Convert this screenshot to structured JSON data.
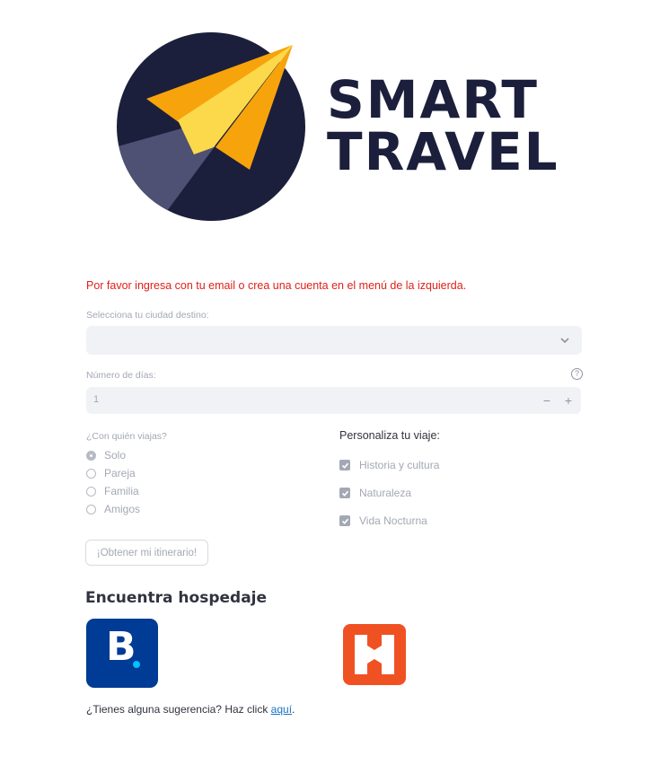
{
  "brand": {
    "line1": "SMART",
    "line2": "TRAVEL"
  },
  "warning": "Por favor ingresa con tu email o crea una cuenta en el menú de la izquierda.",
  "destination": {
    "label": "Selecciona tu ciudad destino:",
    "value": ""
  },
  "days": {
    "label": "Número de días:",
    "value": "1",
    "minus": "−",
    "plus": "+",
    "help": "?"
  },
  "companion": {
    "label": "¿Con quién viajas?",
    "options": [
      "Solo",
      "Pareja",
      "Familia",
      "Amigos"
    ],
    "selected": "Solo"
  },
  "customize": {
    "label": "Personaliza tu viaje:",
    "options": [
      {
        "label": "Historia y cultura",
        "checked": true
      },
      {
        "label": "Naturaleza",
        "checked": true
      },
      {
        "label": "Vida Nocturna",
        "checked": true
      }
    ]
  },
  "submit_label": "¡Obtener mi itinerario!",
  "lodging": {
    "heading": "Encuentra hospedaje",
    "booking_letter": "B"
  },
  "footer": {
    "text": "¿Tienes alguna sugerencia? Haz click ",
    "link": "aquí",
    "suffix": "."
  },
  "colors": {
    "navy": "#1b1f3b",
    "orange": "#f7a30c",
    "warning": "#e0201a",
    "booking": "#003b95",
    "hostelworld": "#f05123"
  }
}
